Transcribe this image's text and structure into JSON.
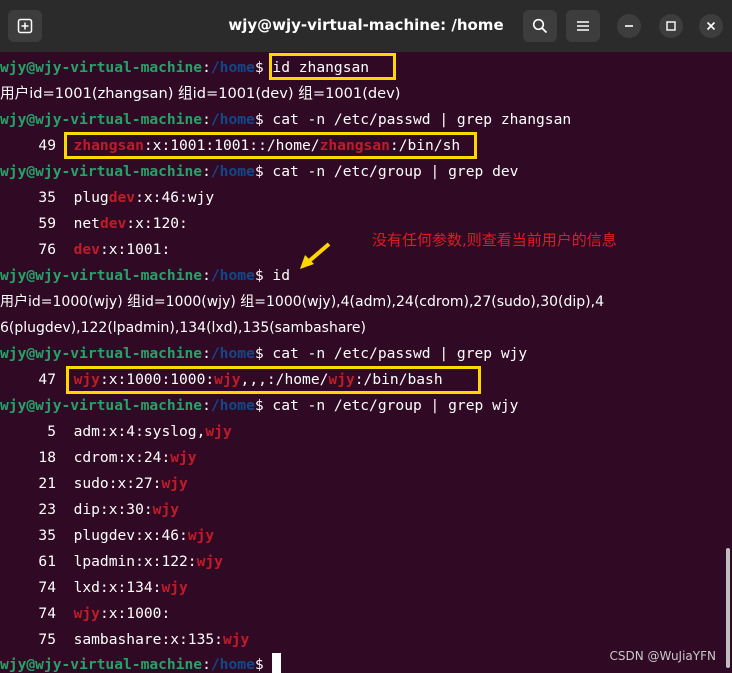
{
  "window": {
    "title": "wjy@wjy-virtual-machine: /home"
  },
  "prompt": {
    "user": "wjy@wjy-virtual-machine",
    "sep": ":",
    "path": "/home",
    "dollar": "$"
  },
  "commands": {
    "c1": " id zhangsan",
    "c2": " cat -n /etc/passwd | grep zhangsan",
    "c3": " cat -n /etc/group | grep dev",
    "c4": " id",
    "c5": " cat -n /etc/passwd | grep wjy",
    "c6": " cat -n /etc/group | grep wjy"
  },
  "output": {
    "id_zhangsan": "用户id=1001(zhangsan) 组id=1001(dev) 组=1001(dev)",
    "passwd_zhangsan": {
      "num": "49",
      "match1": "zhangsan",
      "mid": ":x:1001:1001::/home/",
      "match2": "zhangsan",
      "tail": ":/bin/sh"
    },
    "group_dev": [
      {
        "num": "35",
        "pre": "plug",
        "match": "dev",
        "post": ":x:46:wjy"
      },
      {
        "num": "59",
        "pre": "net",
        "match": "dev",
        "post": ":x:120:"
      },
      {
        "num": "76",
        "pre": "",
        "match": "dev",
        "post": ":x:1001:"
      }
    ],
    "id_wjy_line1": "用户id=1000(wjy) 组id=1000(wjy) 组=1000(wjy),4(adm),24(cdrom),27(sudo),30(dip),4",
    "id_wjy_line2": "6(plugdev),122(lpadmin),134(lxd),135(sambashare)",
    "passwd_wjy": {
      "num": "47",
      "match1": "wjy",
      "mid1": ":x:1000:1000:",
      "match2": "wjy",
      "mid2": ",,,:/home/",
      "match3": "wjy",
      "tail": ":/bin/bash"
    },
    "group_wjy": [
      {
        "num": "5",
        "pre": "adm:x:4:syslog,",
        "match": "wjy",
        "post": ""
      },
      {
        "num": "18",
        "pre": "cdrom:x:24:",
        "match": "wjy",
        "post": ""
      },
      {
        "num": "21",
        "pre": "sudo:x:27:",
        "match": "wjy",
        "post": ""
      },
      {
        "num": "23",
        "pre": "dip:x:30:",
        "match": "wjy",
        "post": ""
      },
      {
        "num": "35",
        "pre": "plugdev:x:46:",
        "match": "wjy",
        "post": ""
      },
      {
        "num": "61",
        "pre": "lpadmin:x:122:",
        "match": "wjy",
        "post": ""
      },
      {
        "num": "74",
        "pre": "lxd:x:134:",
        "match": "wjy",
        "post": ""
      },
      {
        "num": "74",
        "pre": "",
        "match": "wjy",
        "post": ":x:1000:"
      },
      {
        "num": "75",
        "pre": "sambashare:x:135:",
        "match": "wjy",
        "post": ""
      }
    ]
  },
  "annotation": {
    "text": "没有任何参数,则查看当前用户的信息",
    "color": "#e01b24"
  },
  "watermark": "CSDN @WuJiaYFN",
  "colors": {
    "background": "#300a24",
    "prompt_user": "#26a269",
    "prompt_path": "#12488b",
    "match": "#c01c28",
    "highlight_box": "#ffd700"
  },
  "icons": [
    "new-tab-icon",
    "search-icon",
    "menu-icon",
    "minimize-icon",
    "maximize-icon",
    "close-icon"
  ]
}
